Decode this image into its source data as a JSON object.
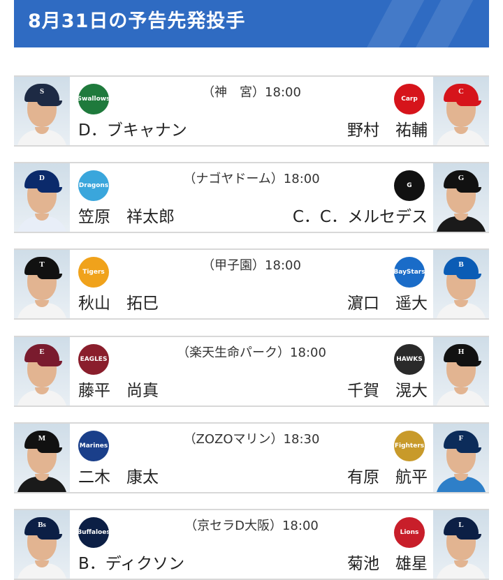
{
  "header": {
    "title": "8月31日の予告先発投手"
  },
  "games": [
    {
      "venue_time": "（神　宮）18:00",
      "home": {
        "pitcher": "D．ブキャナン",
        "team_logo": "swallows-logo",
        "cap_color": "#1d2a44",
        "cap_mark": "S",
        "jersey_color": "#f4f4f4"
      },
      "away": {
        "pitcher": "野村　祐輔",
        "team_logo": "carp-logo",
        "cap_color": "#d6141b",
        "cap_mark": "C",
        "jersey_color": "#f4f4f4"
      }
    },
    {
      "venue_time": "（ナゴヤドーム）18:00",
      "home": {
        "pitcher": "笠原　祥太郎",
        "team_logo": "dragons-logo",
        "cap_color": "#0b2a6b",
        "cap_mark": "D",
        "jersey_color": "#e8eef8"
      },
      "away": {
        "pitcher": "C．C．メルセデス",
        "team_logo": "giants-logo",
        "cap_color": "#111111",
        "cap_mark": "G",
        "jersey_color": "#1a1a1a"
      }
    },
    {
      "venue_time": "（甲子園）18:00",
      "home": {
        "pitcher": "秋山　拓巳",
        "team_logo": "tigers-logo",
        "cap_color": "#111111",
        "cap_mark": "T",
        "jersey_color": "#f4f4f4"
      },
      "away": {
        "pitcher": "濵口　遥大",
        "team_logo": "baystars-logo",
        "cap_color": "#0b5cb5",
        "cap_mark": "B",
        "jersey_color": "#f4f4f4"
      }
    },
    {
      "venue_time": "（楽天生命パーク）18:00",
      "home": {
        "pitcher": "藤平　尚真",
        "team_logo": "eagles-logo",
        "cap_color": "#7a1b2e",
        "cap_mark": "E",
        "jersey_color": "#f4f4f4"
      },
      "away": {
        "pitcher": "千賀　滉大",
        "team_logo": "hawks-logo",
        "cap_color": "#111111",
        "cap_mark": "H",
        "jersey_color": "#f4f4f4"
      }
    },
    {
      "venue_time": "（ZOZOマリン）18:30",
      "home": {
        "pitcher": "二木　康太",
        "team_logo": "marines-logo",
        "cap_color": "#111111",
        "cap_mark": "M",
        "jersey_color": "#1a1a1a"
      },
      "away": {
        "pitcher": "有原　航平",
        "team_logo": "fighters-logo",
        "cap_color": "#0c2c5a",
        "cap_mark": "F",
        "jersey_color": "#2e7fc8"
      }
    },
    {
      "venue_time": "（京セラD大阪）18:00",
      "home": {
        "pitcher": "B．ディクソン",
        "team_logo": "buffaloes-logo",
        "cap_color": "#0c1f45",
        "cap_mark": "Bs",
        "jersey_color": "#f4f4f4"
      },
      "away": {
        "pitcher": "菊池　雄星",
        "team_logo": "lions-logo",
        "cap_color": "#0c1f45",
        "cap_mark": "L",
        "jersey_color": "#f4f4f4"
      }
    }
  ],
  "logo_styles": {
    "swallows-logo": {
      "bg": "#1f7a3c",
      "text": "Swallows"
    },
    "carp-logo": {
      "bg": "#d6141b",
      "text": "Carp"
    },
    "dragons-logo": {
      "bg": "#3aa6dc",
      "text": "Dragons"
    },
    "giants-logo": {
      "bg": "#111111",
      "text": "G"
    },
    "tigers-logo": {
      "bg": "#f0a21b",
      "text": "Tigers"
    },
    "baystars-logo": {
      "bg": "#1a6cc8",
      "text": "BayStars"
    },
    "eagles-logo": {
      "bg": "#8a1e2c",
      "text": "EAGLES"
    },
    "hawks-logo": {
      "bg": "#2a2a2a",
      "text": "HAWKS"
    },
    "marines-logo": {
      "bg": "#1a3f8a",
      "text": "Marines"
    },
    "fighters-logo": {
      "bg": "#c89a2a",
      "text": "Fighters"
    },
    "buffaloes-logo": {
      "bg": "#0c1f45",
      "text": "Buffaloes"
    },
    "lions-logo": {
      "bg": "#c81e2a",
      "text": "Lions"
    }
  }
}
